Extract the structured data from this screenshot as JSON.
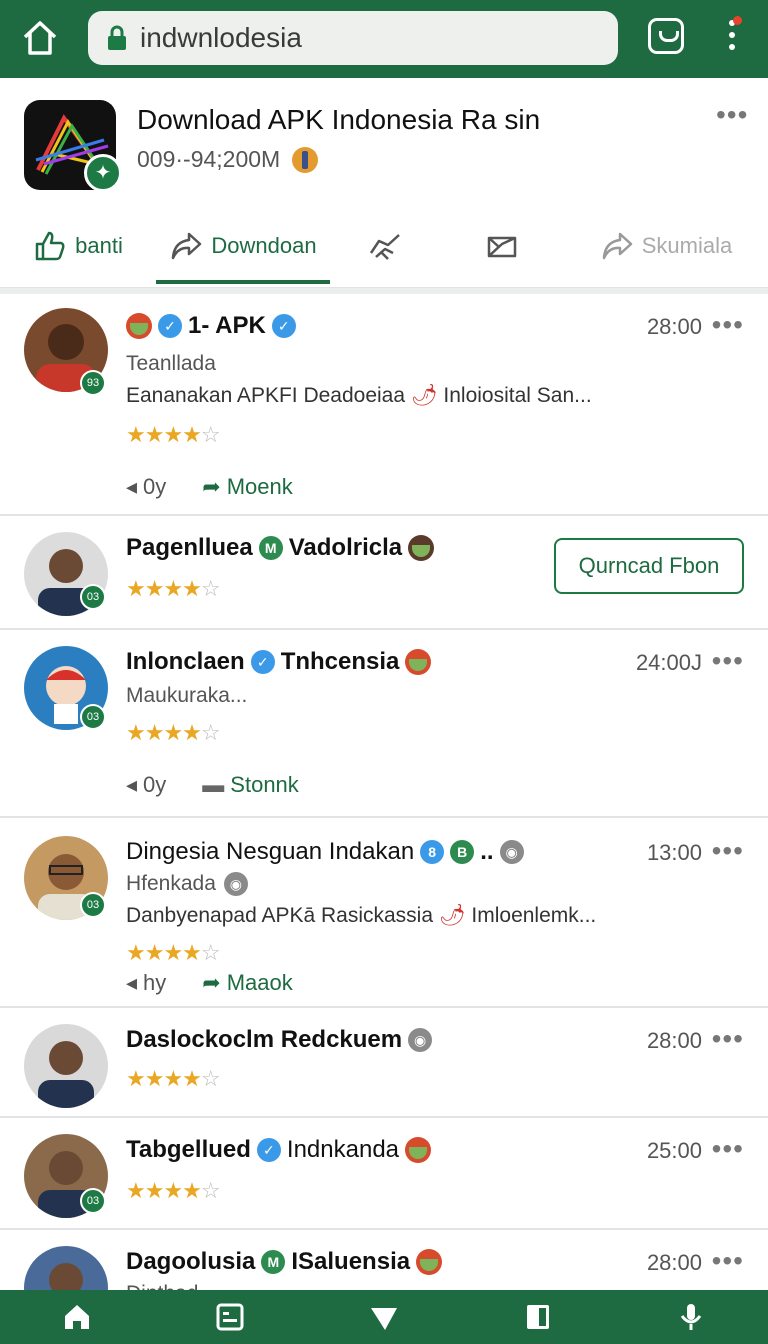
{
  "browser": {
    "url": "indwnlodesia",
    "colors": {
      "brand": "#1e6b41",
      "accent": "#1e7a45"
    }
  },
  "app": {
    "title": "Download APK Indonesia Ra sin",
    "meta": "009·-94;200M",
    "actions": [
      {
        "label": "banti",
        "icon": "thumbs-up-icon"
      },
      {
        "label": "Downdoan",
        "icon": "share-arrow-icon"
      },
      {
        "label": "",
        "icon": "handshake-icon"
      },
      {
        "label": "",
        "icon": "envelope-icon"
      },
      {
        "label": "Skumiala",
        "icon": "share-arrow-icon"
      }
    ]
  },
  "posts": [
    {
      "name": "1- APK",
      "time": "28:00",
      "sub": "Teanllada",
      "desc": "Eananakan APKFI Deadoeiaa",
      "desc2": "Inloiosital San...",
      "rating": 4,
      "count": "0y",
      "link": "Moenk"
    },
    {
      "name": "Pagenlluea",
      "name2": "Vadolricla",
      "rating": 3.5,
      "button": "Qurncad Fbon"
    },
    {
      "name": "Inlonclaen",
      "name2": "Tnhcensia",
      "time": "24:00J",
      "sub": "Maukuraka...",
      "rating": 4,
      "count": "0y",
      "link": "Stonnk"
    },
    {
      "name": "Dingesia Nesguan Indakan",
      "name2": "..",
      "time": "13:00",
      "sub": "Hfenkada",
      "desc": "Danbyenapad APKā Rasickassia",
      "desc2": "Imloenlemk...",
      "rating": 4,
      "count": "hy",
      "link": "Maaok"
    },
    {
      "name": "Daslockoclm Redckuem",
      "time": "28:00",
      "rating": 4
    },
    {
      "name": "Tabgellued",
      "name2": "Indnkanda",
      "time": "25:00",
      "rating": 4
    },
    {
      "name": "Dagoolusia",
      "name2": "ISaluensia",
      "time": "28:00",
      "sub": "Dinthad"
    }
  ],
  "avatar_badges": [
    "93",
    "03",
    "03",
    "03",
    "",
    "03",
    ""
  ]
}
